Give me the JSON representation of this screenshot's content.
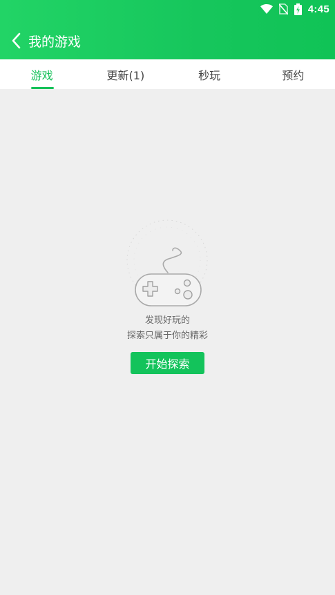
{
  "status_bar": {
    "time": "4:45",
    "icons": [
      "wifi-icon",
      "no-sim-icon",
      "battery-charging-icon"
    ]
  },
  "header": {
    "back_icon": "chevron-left-icon",
    "title": "我的游戏",
    "background_color": "#1ccf60"
  },
  "tabs": [
    {
      "label": "游戏",
      "active": true
    },
    {
      "label": "更新(1)",
      "active": false
    },
    {
      "label": "秒玩",
      "active": false
    },
    {
      "label": "预约",
      "active": false
    }
  ],
  "empty_state": {
    "icon": "game-controller-icon",
    "line1": "发现好玩的",
    "line2": "探索只属于你的精彩",
    "button_label": "开始探索"
  },
  "colors": {
    "accent": "#17c15a",
    "page_background": "#efefef",
    "tab_background": "#ffffff"
  }
}
